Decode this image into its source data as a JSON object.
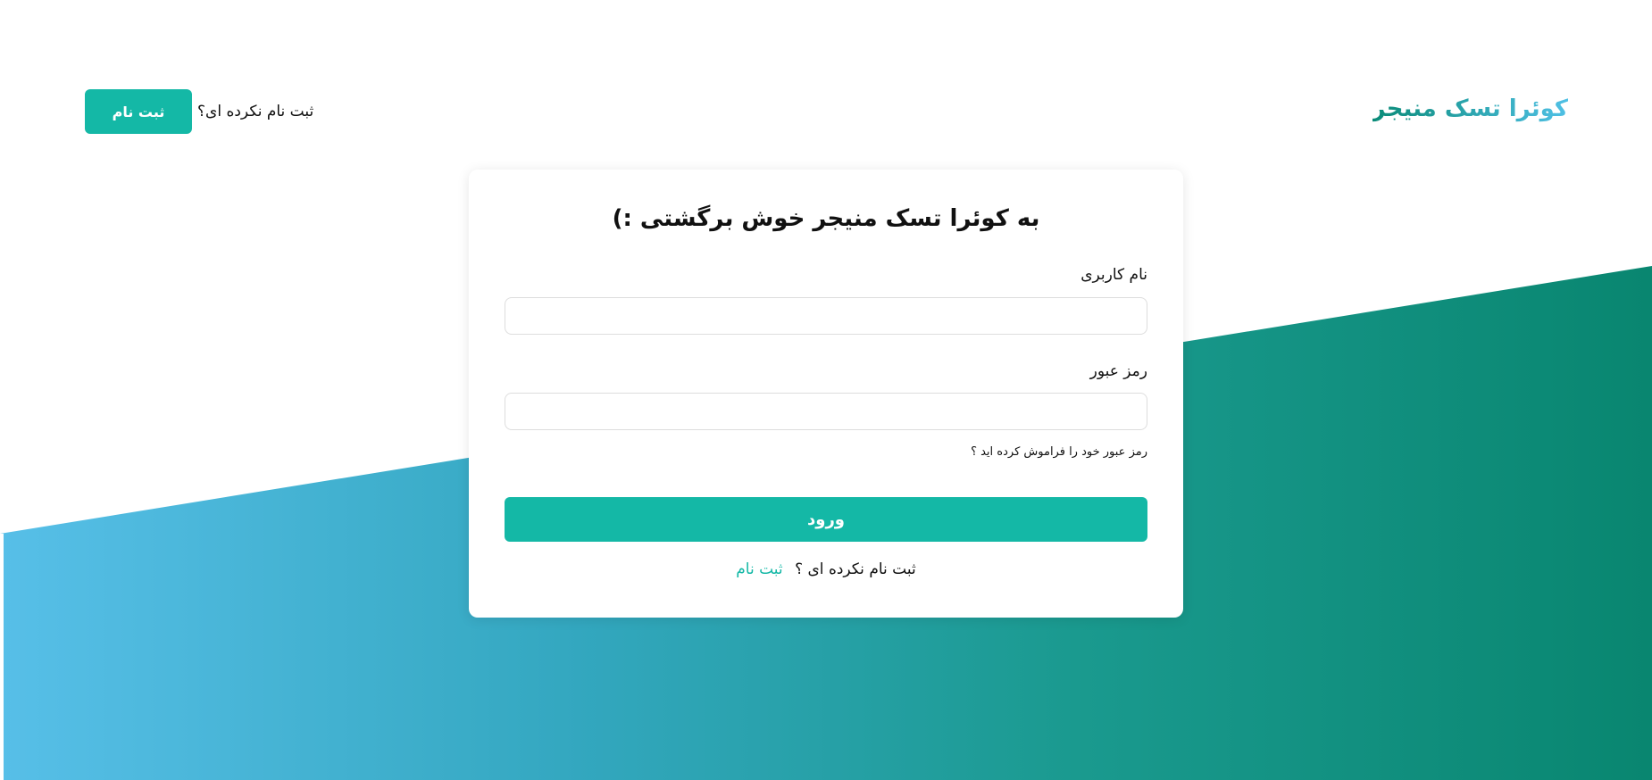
{
  "header": {
    "brand": "کوئرا تسک منیجر",
    "register_prompt": "ثبت نام نکرده ای؟",
    "register_button": "ثبت نام"
  },
  "login_card": {
    "title": "به کوئرا تسک منیجر خوش برگشتی :)",
    "username_label": "نام کاربری",
    "username_value": "",
    "password_label": "رمز عبور",
    "password_value": "",
    "forgot_password_link": "رمز عبور خود را فراموش کرده اید ؟",
    "submit_button": "ورود",
    "bottom_prompt": "ثبت نام نکرده ای ؟",
    "bottom_register_link": "ثبت نام"
  },
  "colors": {
    "accent": "#14b8a6",
    "gradient_start": "#57bfe8",
    "gradient_end": "#098670"
  }
}
